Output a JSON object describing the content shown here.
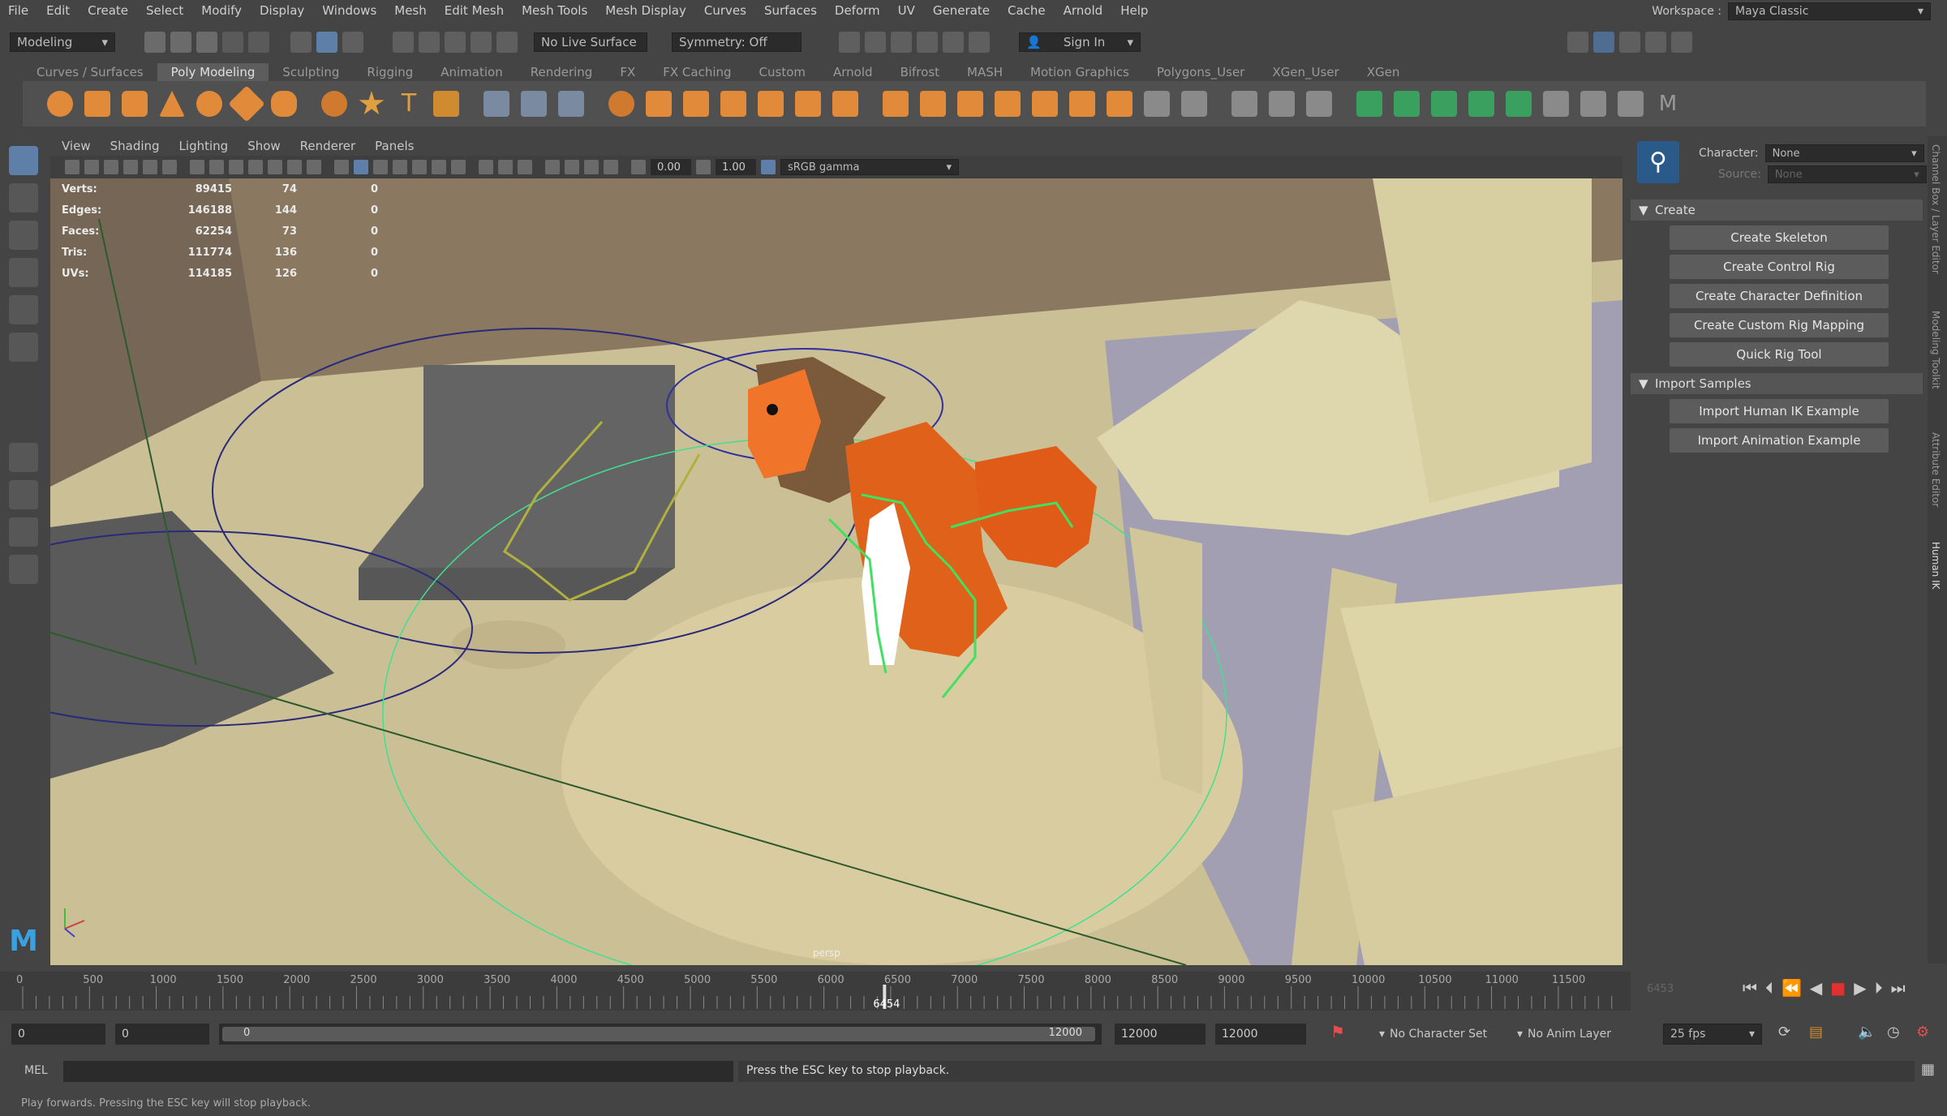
{
  "menu": [
    "File",
    "Edit",
    "Create",
    "Select",
    "Modify",
    "Display",
    "Windows",
    "Mesh",
    "Edit Mesh",
    "Mesh Tools",
    "Mesh Display",
    "Curves",
    "Surfaces",
    "Deform",
    "UV",
    "Generate",
    "Cache",
    "Arnold",
    "Help"
  ],
  "workspace": {
    "label": "Workspace :",
    "value": "Maya Classic"
  },
  "status": {
    "mode": "Modeling",
    "live_surface": "No Live Surface",
    "symmetry": "Symmetry: Off",
    "sign_in": "Sign In"
  },
  "shelf_tabs": [
    "Curves / Surfaces",
    "Poly Modeling",
    "Sculpting",
    "Rigging",
    "Animation",
    "Rendering",
    "FX",
    "FX Caching",
    "Custom",
    "Arnold",
    "Bifrost",
    "MASH",
    "Motion Graphics",
    "Polygons_User",
    "XGen_User",
    "XGen"
  ],
  "shelf_active": "Poly Modeling",
  "panel_menu": [
    "View",
    "Shading",
    "Lighting",
    "Show",
    "Renderer",
    "Panels"
  ],
  "panel_tools": {
    "exposure": "0.00",
    "gamma": "1.00",
    "colorspace": "sRGB gamma"
  },
  "hud": [
    {
      "k": "Verts:",
      "a": "89415",
      "b": "74",
      "c": "0"
    },
    {
      "k": "Edges:",
      "a": "146188",
      "b": "144",
      "c": "0"
    },
    {
      "k": "Faces:",
      "a": "62254",
      "b": "73",
      "c": "0"
    },
    {
      "k": "Tris:",
      "a": "111774",
      "b": "136",
      "c": "0"
    },
    {
      "k": "UVs:",
      "a": "114185",
      "b": "126",
      "c": "0"
    }
  ],
  "camera_label": "persp",
  "right_panel": {
    "character_label": "Character:",
    "character_value": "None",
    "source_label": "Source:",
    "source_value": "None",
    "create_section": "Create",
    "create_buttons": [
      "Create Skeleton",
      "Create Control Rig",
      "Create Character Definition",
      "Create Custom Rig Mapping",
      "Quick Rig Tool"
    ],
    "import_section": "Import Samples",
    "import_buttons": [
      "Import Human IK Example",
      "Import Animation Example"
    ]
  },
  "side_tabs": [
    "Channel Box / Layer Editor",
    "Modeling Toolkit",
    "Attribute Editor",
    "Human IK"
  ],
  "timeline": {
    "ticks": [
      "0",
      "500",
      "1000",
      "1500",
      "2000",
      "2500",
      "3000",
      "3500",
      "4000",
      "4500",
      "5000",
      "5500",
      "6000",
      "6500",
      "7000",
      "7500",
      "8000",
      "8500",
      "9000",
      "9500",
      "10000",
      "10500",
      "11000",
      "11500"
    ],
    "current": "6454",
    "current_field": "6453"
  },
  "range": {
    "start": "0",
    "inner_start": "0",
    "slider_start": "0",
    "slider_end": "12000",
    "end_inner": "12000",
    "end": "12000",
    "char_set": "No Character Set",
    "anim_layer": "No Anim Layer",
    "fps": "25 fps"
  },
  "cmd": {
    "label": "MEL",
    "result": "Press the ESC key to stop playback."
  },
  "help": "Play forwards. Pressing the ESC key will stop playback."
}
